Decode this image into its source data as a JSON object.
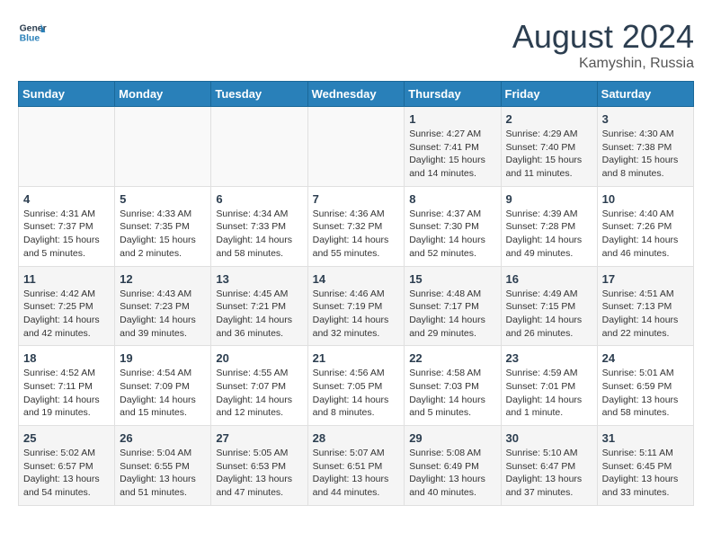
{
  "header": {
    "logo_line1": "General",
    "logo_line2": "Blue",
    "main_title": "August 2024",
    "subtitle": "Kamyshin, Russia"
  },
  "calendar": {
    "days_of_week": [
      "Sunday",
      "Monday",
      "Tuesday",
      "Wednesday",
      "Thursday",
      "Friday",
      "Saturday"
    ],
    "weeks": [
      [
        {
          "day": "",
          "info": ""
        },
        {
          "day": "",
          "info": ""
        },
        {
          "day": "",
          "info": ""
        },
        {
          "day": "",
          "info": ""
        },
        {
          "day": "1",
          "info": "Sunrise: 4:27 AM\nSunset: 7:41 PM\nDaylight: 15 hours\nand 14 minutes."
        },
        {
          "day": "2",
          "info": "Sunrise: 4:29 AM\nSunset: 7:40 PM\nDaylight: 15 hours\nand 11 minutes."
        },
        {
          "day": "3",
          "info": "Sunrise: 4:30 AM\nSunset: 7:38 PM\nDaylight: 15 hours\nand 8 minutes."
        }
      ],
      [
        {
          "day": "4",
          "info": "Sunrise: 4:31 AM\nSunset: 7:37 PM\nDaylight: 15 hours\nand 5 minutes."
        },
        {
          "day": "5",
          "info": "Sunrise: 4:33 AM\nSunset: 7:35 PM\nDaylight: 15 hours\nand 2 minutes."
        },
        {
          "day": "6",
          "info": "Sunrise: 4:34 AM\nSunset: 7:33 PM\nDaylight: 14 hours\nand 58 minutes."
        },
        {
          "day": "7",
          "info": "Sunrise: 4:36 AM\nSunset: 7:32 PM\nDaylight: 14 hours\nand 55 minutes."
        },
        {
          "day": "8",
          "info": "Sunrise: 4:37 AM\nSunset: 7:30 PM\nDaylight: 14 hours\nand 52 minutes."
        },
        {
          "day": "9",
          "info": "Sunrise: 4:39 AM\nSunset: 7:28 PM\nDaylight: 14 hours\nand 49 minutes."
        },
        {
          "day": "10",
          "info": "Sunrise: 4:40 AM\nSunset: 7:26 PM\nDaylight: 14 hours\nand 46 minutes."
        }
      ],
      [
        {
          "day": "11",
          "info": "Sunrise: 4:42 AM\nSunset: 7:25 PM\nDaylight: 14 hours\nand 42 minutes."
        },
        {
          "day": "12",
          "info": "Sunrise: 4:43 AM\nSunset: 7:23 PM\nDaylight: 14 hours\nand 39 minutes."
        },
        {
          "day": "13",
          "info": "Sunrise: 4:45 AM\nSunset: 7:21 PM\nDaylight: 14 hours\nand 36 minutes."
        },
        {
          "day": "14",
          "info": "Sunrise: 4:46 AM\nSunset: 7:19 PM\nDaylight: 14 hours\nand 32 minutes."
        },
        {
          "day": "15",
          "info": "Sunrise: 4:48 AM\nSunset: 7:17 PM\nDaylight: 14 hours\nand 29 minutes."
        },
        {
          "day": "16",
          "info": "Sunrise: 4:49 AM\nSunset: 7:15 PM\nDaylight: 14 hours\nand 26 minutes."
        },
        {
          "day": "17",
          "info": "Sunrise: 4:51 AM\nSunset: 7:13 PM\nDaylight: 14 hours\nand 22 minutes."
        }
      ],
      [
        {
          "day": "18",
          "info": "Sunrise: 4:52 AM\nSunset: 7:11 PM\nDaylight: 14 hours\nand 19 minutes."
        },
        {
          "day": "19",
          "info": "Sunrise: 4:54 AM\nSunset: 7:09 PM\nDaylight: 14 hours\nand 15 minutes."
        },
        {
          "day": "20",
          "info": "Sunrise: 4:55 AM\nSunset: 7:07 PM\nDaylight: 14 hours\nand 12 minutes."
        },
        {
          "day": "21",
          "info": "Sunrise: 4:56 AM\nSunset: 7:05 PM\nDaylight: 14 hours\nand 8 minutes."
        },
        {
          "day": "22",
          "info": "Sunrise: 4:58 AM\nSunset: 7:03 PM\nDaylight: 14 hours\nand 5 minutes."
        },
        {
          "day": "23",
          "info": "Sunrise: 4:59 AM\nSunset: 7:01 PM\nDaylight: 14 hours\nand 1 minute."
        },
        {
          "day": "24",
          "info": "Sunrise: 5:01 AM\nSunset: 6:59 PM\nDaylight: 13 hours\nand 58 minutes."
        }
      ],
      [
        {
          "day": "25",
          "info": "Sunrise: 5:02 AM\nSunset: 6:57 PM\nDaylight: 13 hours\nand 54 minutes."
        },
        {
          "day": "26",
          "info": "Sunrise: 5:04 AM\nSunset: 6:55 PM\nDaylight: 13 hours\nand 51 minutes."
        },
        {
          "day": "27",
          "info": "Sunrise: 5:05 AM\nSunset: 6:53 PM\nDaylight: 13 hours\nand 47 minutes."
        },
        {
          "day": "28",
          "info": "Sunrise: 5:07 AM\nSunset: 6:51 PM\nDaylight: 13 hours\nand 44 minutes."
        },
        {
          "day": "29",
          "info": "Sunrise: 5:08 AM\nSunset: 6:49 PM\nDaylight: 13 hours\nand 40 minutes."
        },
        {
          "day": "30",
          "info": "Sunrise: 5:10 AM\nSunset: 6:47 PM\nDaylight: 13 hours\nand 37 minutes."
        },
        {
          "day": "31",
          "info": "Sunrise: 5:11 AM\nSunset: 6:45 PM\nDaylight: 13 hours\nand 33 minutes."
        }
      ]
    ]
  }
}
